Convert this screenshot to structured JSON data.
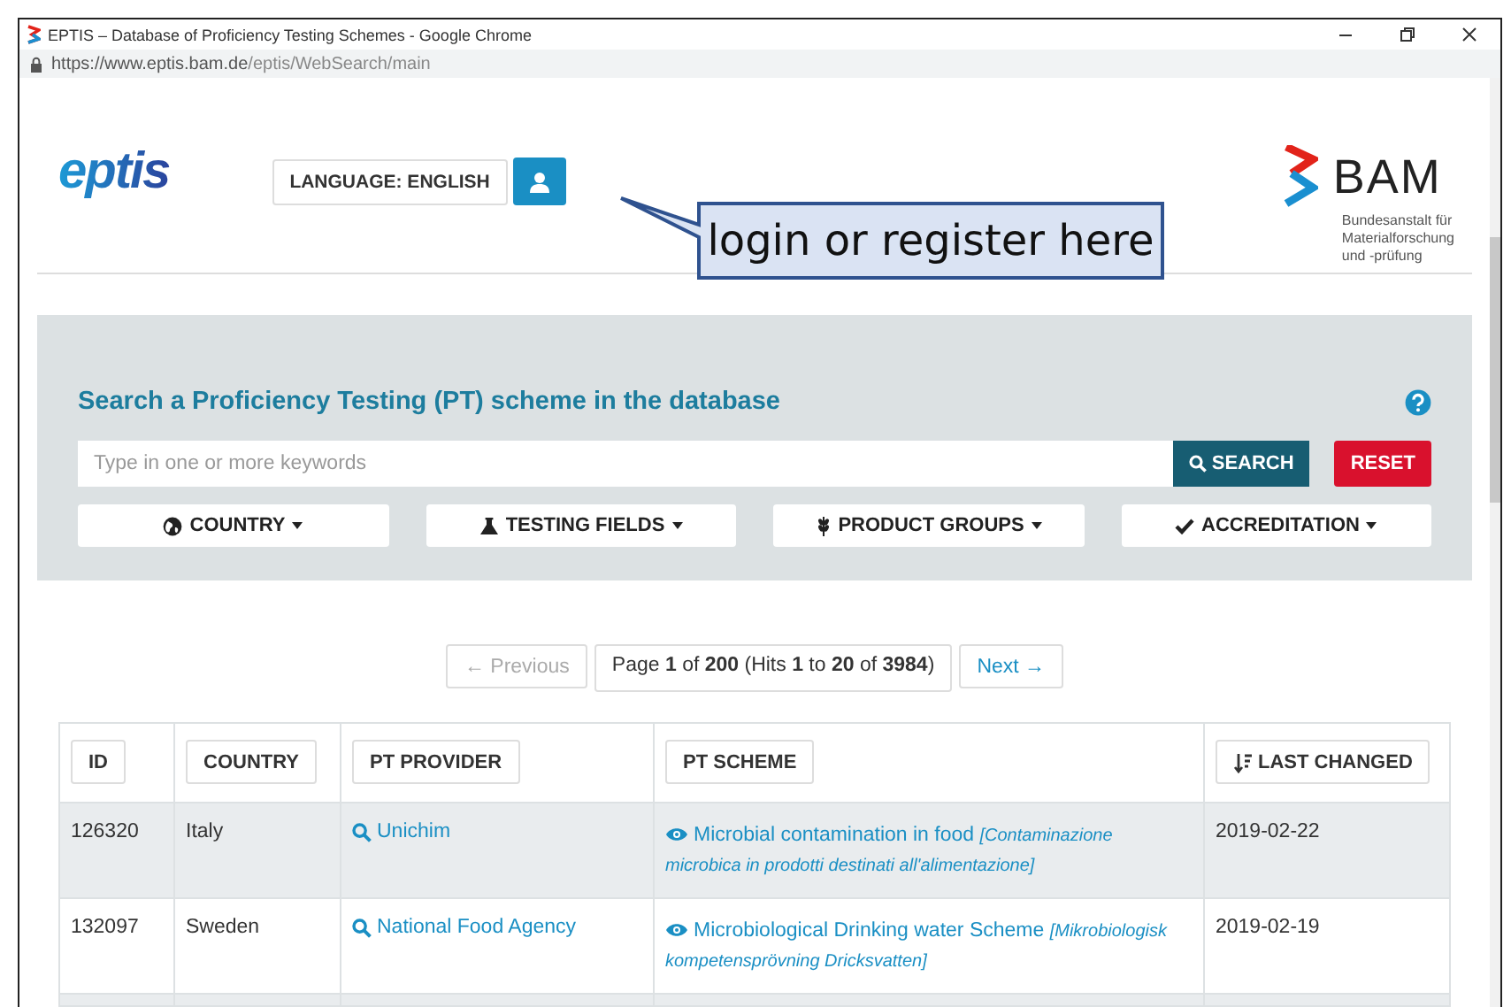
{
  "window": {
    "title": "EPTIS – Database of Proficiency Testing Schemes - Google Chrome",
    "url_host": "https://www.eptis.bam.de",
    "url_path": "/eptis/WebSearch/main"
  },
  "header": {
    "logo": "eptis",
    "language_button": "LANGUAGE: ENGLISH",
    "bam_logo": "BAM",
    "bam_subtitle": [
      "Bundesanstalt für",
      "Materialforschung",
      "und -prüfung"
    ],
    "callout": "login or register here"
  },
  "search": {
    "title": "Search a Proficiency Testing (PT) scheme in the database",
    "placeholder": "Type in one or more keywords",
    "search_button": "SEARCH",
    "reset_button": "RESET",
    "filters": [
      {
        "kind": "globe",
        "label": "COUNTRY"
      },
      {
        "kind": "flask",
        "label": "TESTING FIELDS"
      },
      {
        "kind": "wheat",
        "label": "PRODUCT GROUPS"
      },
      {
        "kind": "check",
        "label": "ACCREDITATION"
      }
    ]
  },
  "pager": {
    "previous": {
      "label": "← Previous",
      "disabled": true
    },
    "status": "Page **1** of **200** (Hits **1** to **20** of **3984**)",
    "next": {
      "label": "Next →",
      "disabled": false
    }
  },
  "table": {
    "columns": [
      {
        "label": "ID",
        "sorted": false
      },
      {
        "label": "COUNTRY",
        "sorted": false
      },
      {
        "label": "PT PROVIDER",
        "sorted": false
      },
      {
        "label": "PT SCHEME",
        "sorted": false
      },
      {
        "label": "LAST CHANGED",
        "sorted": true
      }
    ],
    "rows": [
      {
        "id": "126320",
        "country": "Italy",
        "provider": "Unichim",
        "scheme": "Microbial contamination in food",
        "scheme_translation": "[Contaminazione microbica in prodotti destinati all'alimentazione]",
        "last_changed": "2019-02-22"
      },
      {
        "id": "132097",
        "country": "Sweden",
        "provider": "National Food Agency",
        "scheme": "Microbiological Drinking water Scheme",
        "scheme_translation": "[Mikrobiologisk kompetensprövning Dricksvatten]",
        "last_changed": "2019-02-19"
      }
    ]
  }
}
